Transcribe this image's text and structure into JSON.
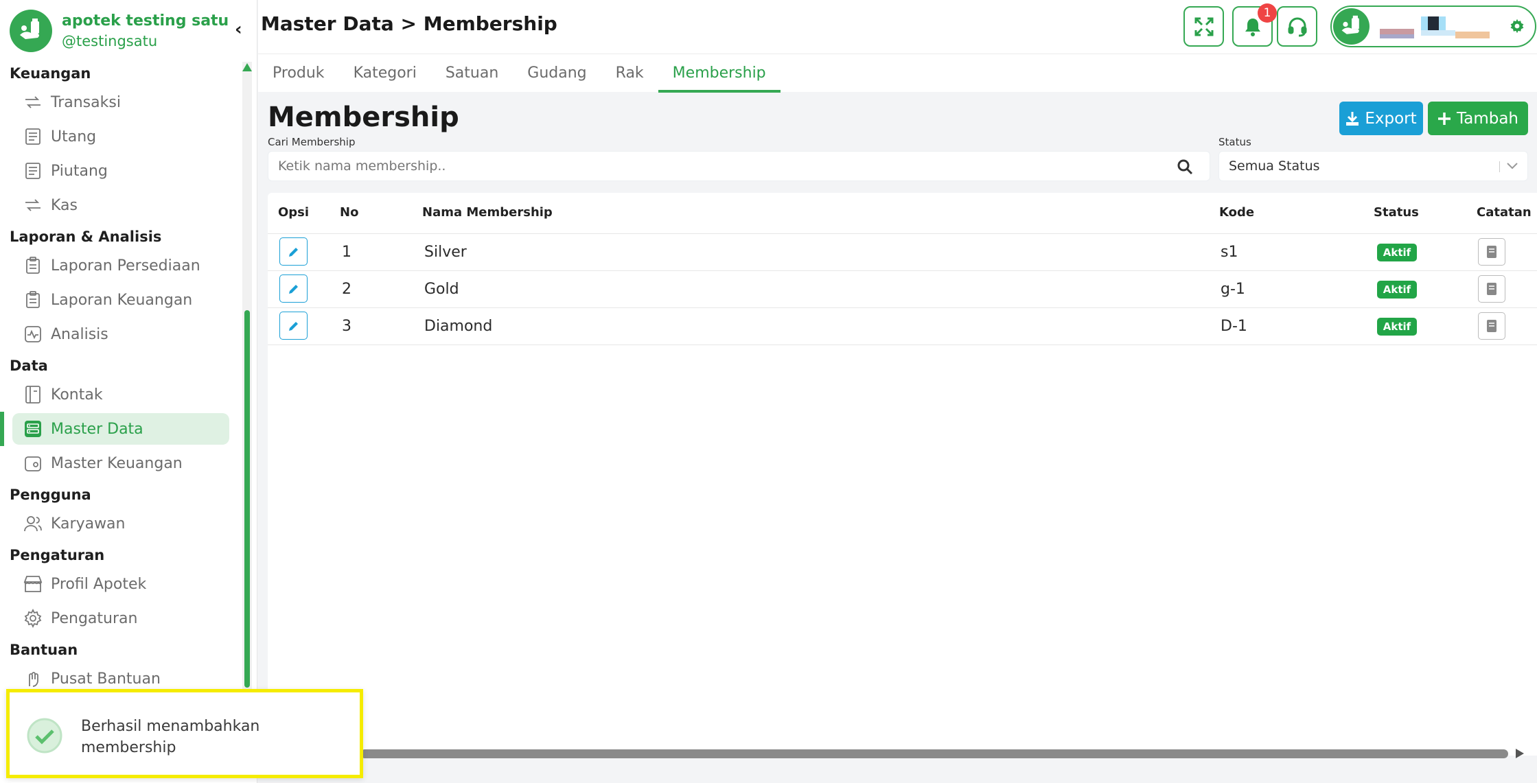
{
  "brand": {
    "name": "apotek testing satu",
    "handle": "@testingsatu"
  },
  "header": {
    "breadcrumb": "Master Data > Membership",
    "notification_count": "1"
  },
  "sidebar": {
    "sections": [
      {
        "title": "Keuangan",
        "items": [
          {
            "label": "Transaksi"
          },
          {
            "label": "Utang"
          },
          {
            "label": "Piutang"
          },
          {
            "label": "Kas"
          }
        ]
      },
      {
        "title": "Laporan & Analisis",
        "items": [
          {
            "label": "Laporan Persediaan"
          },
          {
            "label": "Laporan Keuangan"
          },
          {
            "label": "Analisis"
          }
        ]
      },
      {
        "title": "Data",
        "items": [
          {
            "label": "Kontak"
          },
          {
            "label": "Master Data",
            "active": true
          },
          {
            "label": "Master Keuangan"
          }
        ]
      },
      {
        "title": "Pengguna",
        "items": [
          {
            "label": "Karyawan"
          }
        ]
      },
      {
        "title": "Pengaturan",
        "items": [
          {
            "label": "Profil Apotek"
          },
          {
            "label": "Pengaturan"
          }
        ]
      },
      {
        "title": "Bantuan",
        "items": [
          {
            "label": "Pusat Bantuan"
          }
        ]
      }
    ]
  },
  "tabs": [
    {
      "label": "Produk"
    },
    {
      "label": "Kategori"
    },
    {
      "label": "Satuan"
    },
    {
      "label": "Gudang"
    },
    {
      "label": "Rak"
    },
    {
      "label": "Membership",
      "active": true
    }
  ],
  "page": {
    "title": "Membership",
    "export_label": "Export",
    "add_label": "Tambah",
    "search_label": "Cari Membership",
    "search_placeholder": "Ketik nama membership..",
    "status_label": "Status",
    "status_value": "Semua Status"
  },
  "table": {
    "columns": [
      "Opsi",
      "No",
      "Nama Membership",
      "Kode",
      "Status",
      "Catatan"
    ],
    "rows": [
      {
        "no": "1",
        "name": "Silver",
        "code": "s1",
        "status": "Aktif"
      },
      {
        "no": "2",
        "name": "Gold",
        "code": "g-1",
        "status": "Aktif"
      },
      {
        "no": "3",
        "name": "Diamond",
        "code": "D-1",
        "status": "Aktif"
      }
    ]
  },
  "toast": {
    "message": "Berhasil menambahkan membership"
  },
  "colors": {
    "primary": "#35a853",
    "accent_blue": "#1a9fd6",
    "toast_border": "#f5ec00",
    "badge_red": "#ef4444"
  },
  "icons": {
    "sidebar": [
      "transfer-icon",
      "receipt-icon",
      "receipt-icon",
      "transfer-icon",
      "clipboard-icon",
      "clipboard-icon",
      "pulse-icon",
      "contact-book-icon",
      "database-icon",
      "wallet-icon",
      "users-icon",
      "store-icon",
      "gear-icon",
      "hand-icon"
    ],
    "header": [
      "fullscreen-icon",
      "bell-icon",
      "headset-icon",
      "gear-icon"
    ]
  }
}
